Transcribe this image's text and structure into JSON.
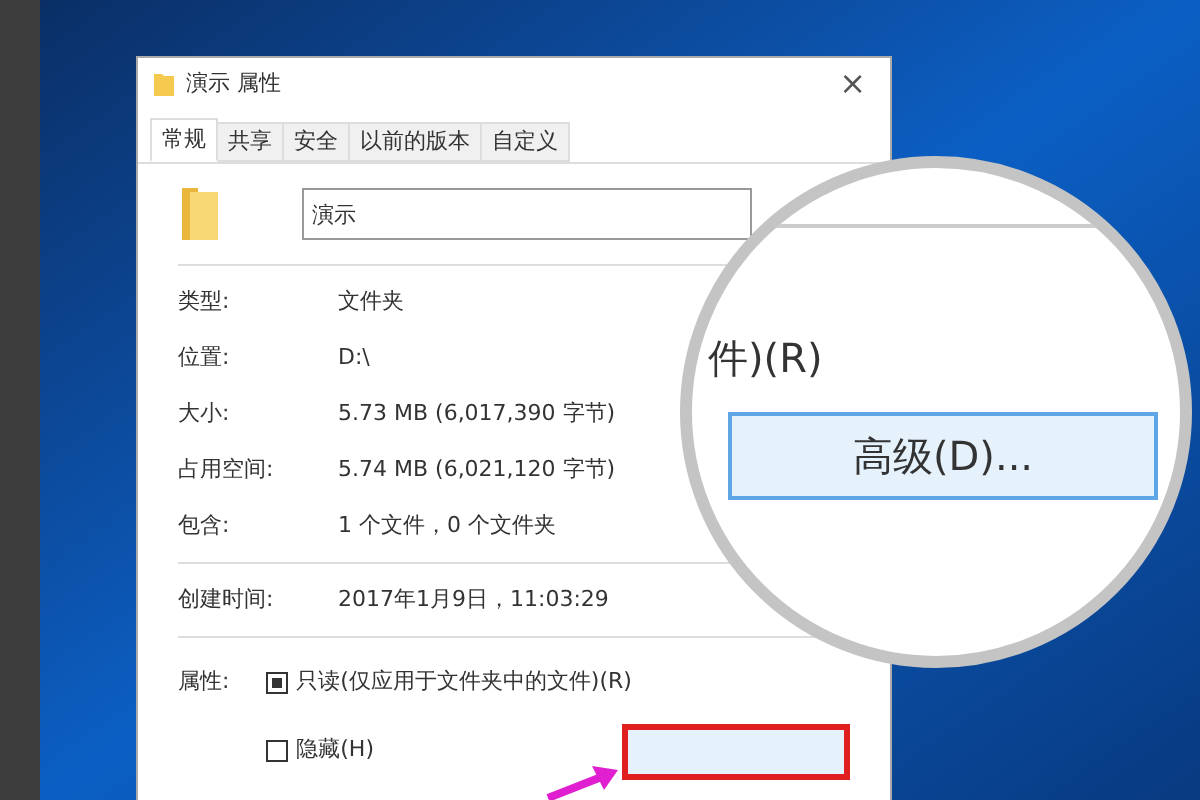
{
  "window": {
    "title": "演示 属性",
    "close": "×"
  },
  "tabs": [
    {
      "label": "常规",
      "selected": true
    },
    {
      "label": "共享",
      "selected": false
    },
    {
      "label": "安全",
      "selected": false
    },
    {
      "label": "以前的版本",
      "selected": false
    },
    {
      "label": "自定义",
      "selected": false
    }
  ],
  "name_field": {
    "value": "演示"
  },
  "groups": [
    [
      {
        "label": "类型:",
        "value": "文件夹"
      },
      {
        "label": "位置:",
        "value": "D:\\"
      },
      {
        "label": "大小:",
        "value": "5.73 MB (6,017,390 字节)"
      },
      {
        "label": "占用空间:",
        "value": "5.74 MB (6,021,120 字节)"
      },
      {
        "label": "包含:",
        "value": "1 个文件，0 个文件夹"
      }
    ],
    [
      {
        "label": "创建时间:",
        "value": "2017年1月9日，11:03:29"
      }
    ]
  ],
  "attributes": {
    "label": "属性:",
    "options": [
      {
        "label": "只读(仅应用于文件夹中的文件)(R)",
        "checked": true
      },
      {
        "label": "隐藏(H)",
        "checked": false
      }
    ],
    "advanced_highlighted": true
  },
  "magnifier": {
    "text": "件)(R)",
    "button": "高级(D)..."
  }
}
